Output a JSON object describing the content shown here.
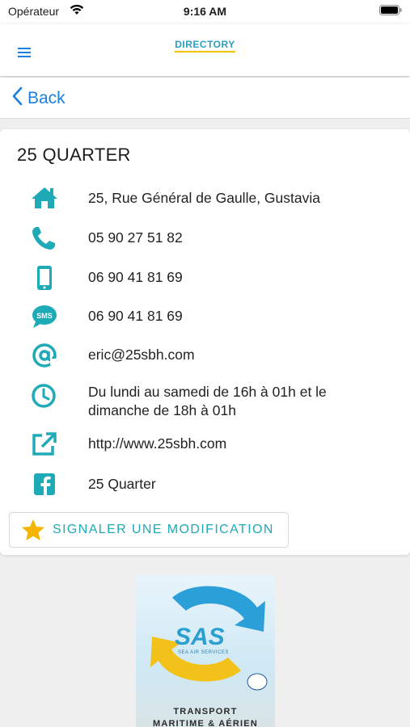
{
  "status_bar": {
    "carrier": "Opérateur",
    "time": "9:16 AM"
  },
  "navbar": {
    "logo_text": "DIRECTORY"
  },
  "back": {
    "label": "Back"
  },
  "listing": {
    "title": "25 QUARTER",
    "address": "25, Rue Général de Gaulle, Gustavia",
    "phone": "05 90 27 51 82",
    "mobile": "06 90 41 81 69",
    "sms": "06 90 41 81 69",
    "sms_icon_text": "SMS",
    "email": "eric@25sbh.com",
    "hours": "Du lundi au samedi de 16h à 01h et le dimanche de 18h à 01h",
    "website": "http://www.25sbh.com",
    "facebook": "25 Quarter"
  },
  "actions": {
    "report_label": "SIGNALER UNE MODIFICATION"
  },
  "ad": {
    "brand": "SAS",
    "brand_sub": "SEA AIR SERVICES",
    "line1": "TRANSPORT",
    "line2": "MARITIME & AÉRIEN"
  },
  "colors": {
    "accent": "#1eaab6",
    "link": "#1a7fe0",
    "star": "#f5b400"
  }
}
